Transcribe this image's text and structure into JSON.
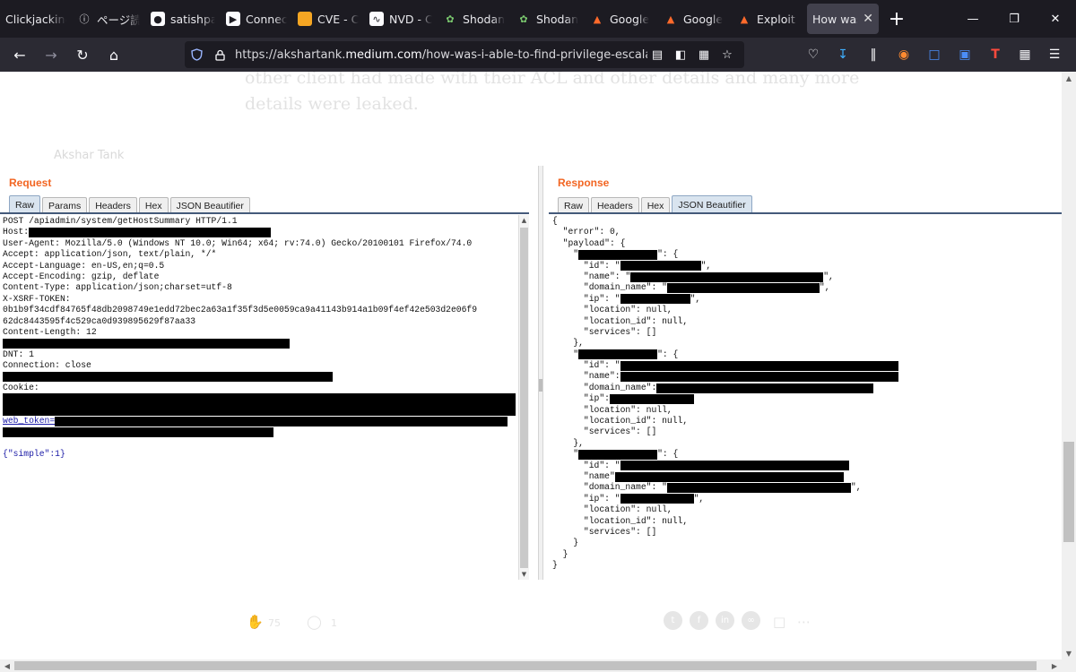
{
  "browser": {
    "tabs": [
      {
        "label": "Clickjacking",
        "icon": "blank-page-icon",
        "active": false
      },
      {
        "label": "ページ読",
        "icon": "info-icon",
        "active": false
      },
      {
        "label": "satishpa",
        "icon": "github-icon",
        "active": false
      },
      {
        "label": "Connect",
        "icon": "terminal-icon",
        "active": false
      },
      {
        "label": "CVE - C",
        "icon": "cve-icon",
        "active": false
      },
      {
        "label": "NVD - C",
        "icon": "nvd-icon",
        "active": false
      },
      {
        "label": "Shodan",
        "icon": "shodan-icon",
        "active": false
      },
      {
        "label": "Shodan",
        "icon": "shodan-icon",
        "active": false
      },
      {
        "label": "Google",
        "icon": "google-icon",
        "active": false
      },
      {
        "label": "Google",
        "icon": "google-icon",
        "active": false
      },
      {
        "label": "Exploit D",
        "icon": "exploit-db-icon",
        "active": false
      },
      {
        "label": "How was",
        "icon": "medium-icon",
        "active": true
      }
    ],
    "url_prefix": "https://akshartank.",
    "url_host": "medium.com",
    "url_path": "/how-was-i-able-to-find-privilege-escalation-b"
  },
  "article": {
    "line1": "other client had made with their ACL and other details and many more",
    "line2": "details were leaked.",
    "author": "Akshar Tank",
    "claps": "75",
    "comments": "1"
  },
  "request": {
    "title": "Request",
    "tabs": [
      "Raw",
      "Params",
      "Headers",
      "Hex",
      "JSON Beautifier"
    ],
    "selected_tab": "Raw",
    "lines": [
      {
        "text": "POST /apiadmin/system/getHostSummary HTTP/1.1"
      },
      {
        "text": "Host:",
        "redact": 270
      },
      {
        "text": "User-Agent: Mozilla/5.0 (Windows NT 10.0; Win64; x64; rv:74.0) Gecko/20100101 Firefox/74.0"
      },
      {
        "text": "Accept: application/json, text/plain, */*"
      },
      {
        "text": "Accept-Language: en-US,en;q=0.5"
      },
      {
        "text": "Accept-Encoding: gzip, deflate"
      },
      {
        "text": "Content-Type: application/json;charset=utf-8"
      },
      {
        "text": "X-XSRF-TOKEN:"
      },
      {
        "text": "0b1b9f34cdf84765f48db2098749e1edd72bec2a63a1f35f3d5e0059ca9a41143b914a1b09f4ef42e503d2e06f9"
      },
      {
        "text": "62dc8443595f4c529ca0d939895629f87aa33"
      },
      {
        "text": "Content-Length: 12"
      },
      {
        "text": "",
        "redact": 320
      },
      {
        "text": "DNT: 1"
      },
      {
        "text": "Connection: close"
      },
      {
        "text": "",
        "redact": 368
      },
      {
        "text": "Cookie:"
      },
      {
        "text": "",
        "redact": 574
      },
      {
        "text": "",
        "redact": 574
      },
      {
        "text": "web_token=",
        "underline": true,
        "redact": 505
      },
      {
        "text": "",
        "redact": 302
      },
      {
        "text": ""
      },
      {
        "text": "{\"simple\":1}",
        "json": true
      }
    ]
  },
  "response": {
    "title": "Response",
    "tabs": [
      "Raw",
      "Headers",
      "Hex",
      "JSON Beautifier"
    ],
    "selected_tab": "JSON Beautifier",
    "lines": [
      {
        "text": "{"
      },
      {
        "text": "  \"error\": 0,"
      },
      {
        "text": "  \"payload\": {"
      },
      {
        "text": "    \"",
        "redact": 88,
        "tail": "\": {"
      },
      {
        "text": "      \"id\": \"",
        "redact": 90,
        "tail": "\","
      },
      {
        "text": "      \"name\": \"",
        "redact": 215,
        "tail": "\","
      },
      {
        "text": "      \"domain_name\": \"",
        "redact": 170,
        "tail": "\","
      },
      {
        "text": "      \"ip\": \"",
        "redact": 78,
        "tail": "\","
      },
      {
        "text": "      \"location\": null,"
      },
      {
        "text": "      \"location_id\": null,"
      },
      {
        "text": "      \"services\": []"
      },
      {
        "text": "    },"
      },
      {
        "text": "    \"",
        "redact": 88,
        "tail": "\": {"
      },
      {
        "text": "      \"id\": \"",
        "redact": 310
      },
      {
        "text": "      \"name\":",
        "redact": 310
      },
      {
        "text": "      \"domain_name\":",
        "redact": 242
      },
      {
        "text": "      \"ip\":",
        "redact": 94
      },
      {
        "text": "      \"location\": null,"
      },
      {
        "text": "      \"location_id\": null,"
      },
      {
        "text": "      \"services\": []"
      },
      {
        "text": "    },"
      },
      {
        "text": "    \"",
        "redact": 88,
        "tail": "\": {"
      },
      {
        "text": "      \"id\": \"",
        "redact": 255
      },
      {
        "text": "      \"name\"",
        "redact": 255
      },
      {
        "text": "      \"domain_name\": \"",
        "redact": 205,
        "tail": "\","
      },
      {
        "text": "      \"ip\": \"",
        "redact": 82,
        "tail": "\","
      },
      {
        "text": "      \"location\": null,"
      },
      {
        "text": "      \"location_id\": null,"
      },
      {
        "text": "      \"services\": []"
      },
      {
        "text": "    }"
      },
      {
        "text": "  }"
      },
      {
        "text": "}"
      }
    ]
  }
}
